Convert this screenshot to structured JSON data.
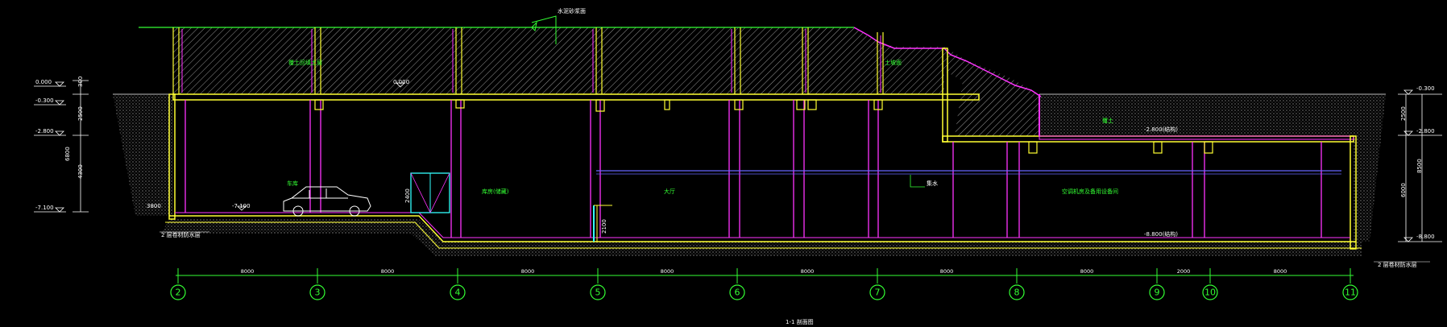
{
  "colors": {
    "background": "#000000",
    "wall": "#ffff33",
    "column": "#ff33ff",
    "soil": "#cccccc",
    "grid": "#33ff33",
    "dimension": "#ffffff",
    "note": "#33ff33",
    "door": "#33ffff",
    "beam": "#6666ff"
  },
  "drawing": {
    "title": "1-1 剖面图",
    "top_note": "水泥砂浆面",
    "fill_label": "覆土回填土层",
    "slope_label": "土坡面",
    "back_fill_label": "覆土"
  },
  "levels_left": [
    "0.000",
    "-0.300",
    "-2.800",
    "-7.100"
  ],
  "levels_right": [
    "-0.300",
    "-2.800",
    "-8.800"
  ],
  "inner_levels": {
    "roof": "0.000",
    "garage_floor": "-7.100",
    "slab_mid": "-2.800(结构)",
    "deep_floor": "-8.800(结构)"
  },
  "left_vertical_dims": [
    "300",
    "2500",
    "6800",
    "4300"
  ],
  "right_vertical_dims": [
    "2500",
    "6000",
    "8500"
  ],
  "rooms": {
    "garage": "车库",
    "storage": "库房(储藏)",
    "hall": "大厅",
    "plant": "空调机房及备用设备间",
    "drain": "集水"
  },
  "door_heights": [
    "2400",
    "2100"
  ],
  "edge_notes": {
    "left_width": "3800",
    "left": "2 层卷材防水层",
    "right": "2 层卷材防水层"
  },
  "grid_dimensions": [
    "8000",
    "8000",
    "8000",
    "8000",
    "8000",
    "8000",
    "8000",
    "2000",
    "8000"
  ],
  "grid_axes": [
    "2",
    "3",
    "4",
    "5",
    "6",
    "7",
    "8",
    "9",
    "10",
    "11"
  ]
}
